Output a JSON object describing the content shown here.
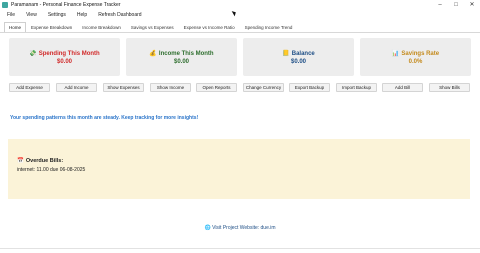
{
  "window": {
    "title": "Paramanam - Personal Finance Expense Tracker",
    "controls": {
      "minimize": "–",
      "maximize": "□",
      "close": "✕"
    }
  },
  "menu": {
    "items": [
      "File",
      "View",
      "Settings",
      "Help",
      "Refresh Dashboard"
    ]
  },
  "tabs": {
    "items": [
      "Home",
      "Expense Breakdown",
      "Income Breakdown",
      "Savings vs Expenses",
      "Expense vs Income Ratio",
      "Spending Income Trend"
    ],
    "active": "Home"
  },
  "cards": {
    "spending": {
      "label": "Spending This Month",
      "value": "$0.00",
      "icon": "money-icon",
      "color": "#d12a2a"
    },
    "income": {
      "label": "Income This Month",
      "value": "$0.00",
      "icon": "money-bag-icon",
      "color": "#2f6f2f"
    },
    "balance": {
      "label": "Balance",
      "value": "$0.00",
      "icon": "ledger-icon",
      "color": "#1f4f86"
    },
    "savings": {
      "label": "Savings Rate",
      "value": "0.0%",
      "icon": "chart-icon",
      "color": "#c48a1c"
    }
  },
  "actions": {
    "add_expense": "Add Expense",
    "add_income": "Add Income",
    "show_expenses": "Show Expenses",
    "show_income": "Show Income",
    "open_reports": "Open Reports",
    "change_currency": "Change Currency",
    "export_backup": "Export Backup",
    "import_backup": "Import Backup",
    "add_bill": "Add Bill",
    "show_bills": "Show Bills"
  },
  "insight": {
    "text": "Your spending patterns this month are steady. Keep tracking for more insights!"
  },
  "bills": {
    "title": "Overdue Bills:",
    "icon": "calendar-icon",
    "entry": "internet: 11.00 due 06-08-2025"
  },
  "footer": {
    "text": "Visit Project Website: due.im",
    "icon": "globe-icon"
  }
}
